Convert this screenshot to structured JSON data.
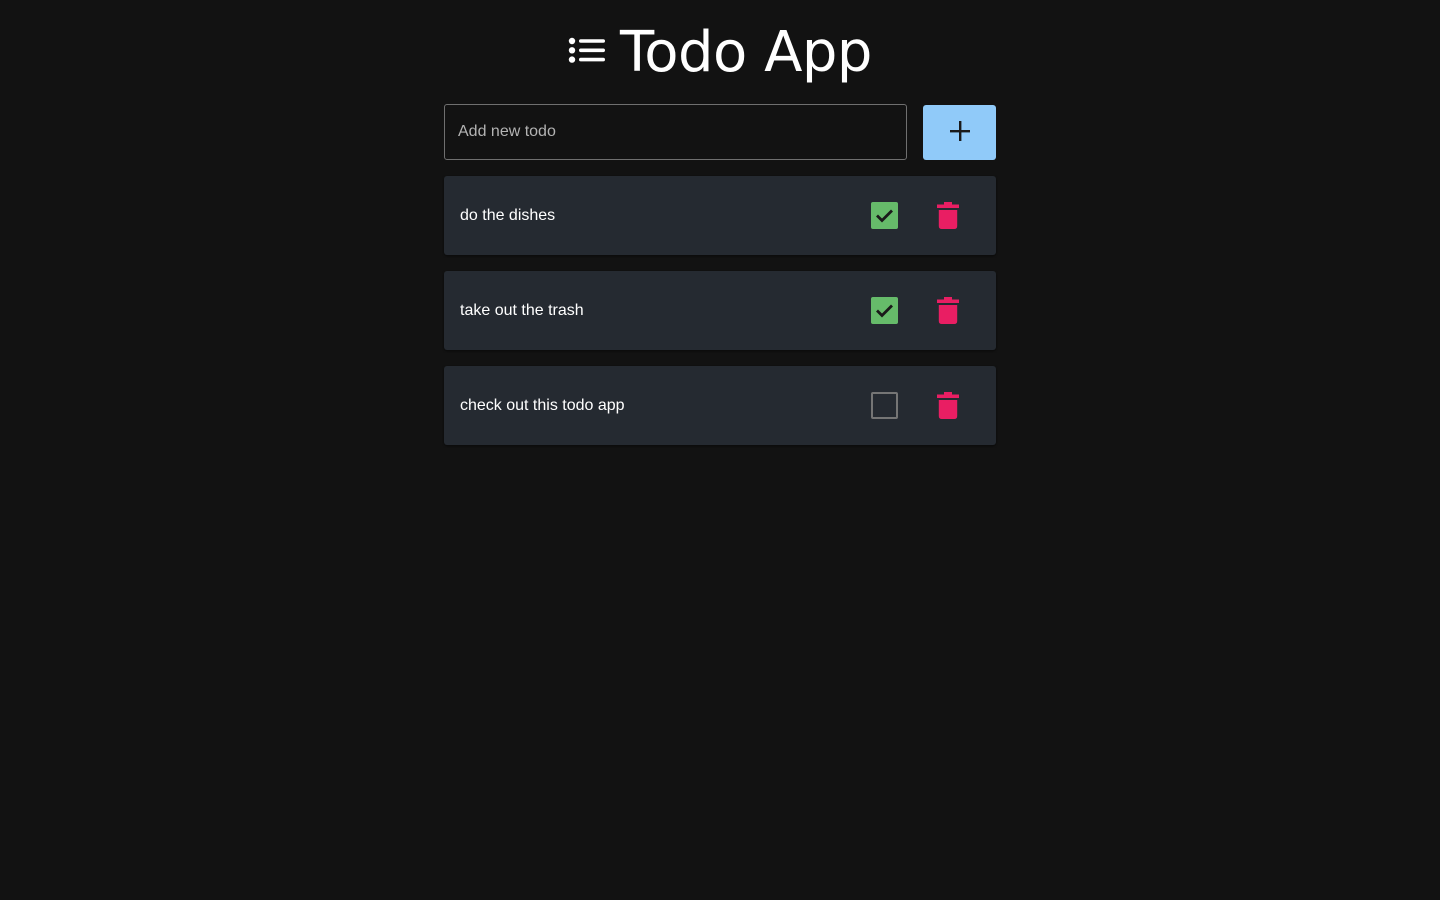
{
  "header": {
    "title": "Todo App",
    "icon": "list-icon"
  },
  "add_todo": {
    "placeholder": "Add new todo",
    "value": "",
    "button_icon": "plus-icon"
  },
  "todos": [
    {
      "text": "do the dishes",
      "completed": true
    },
    {
      "text": "take out the trash",
      "completed": true
    },
    {
      "text": "check out this todo app",
      "completed": false
    }
  ],
  "colors": {
    "background": "#121212",
    "card": "#252a31",
    "accent_button": "#90caf9",
    "checkbox_checked": "#66bb6a",
    "delete_icon": "#e91e63"
  }
}
